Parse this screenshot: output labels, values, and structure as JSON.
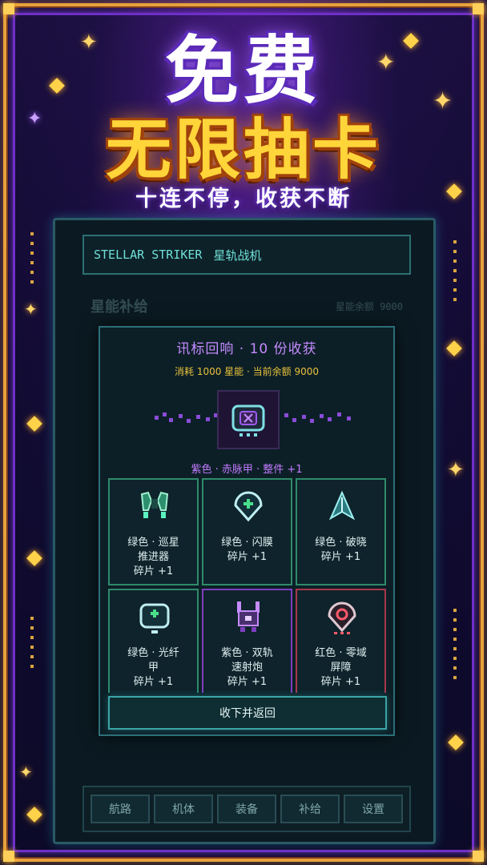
{
  "promo": {
    "title_top": "免费",
    "title_main": "无限抽卡",
    "subtitle": "十连不停，收获不断"
  },
  "app": {
    "name_en": "STELLAR STRIKER",
    "name_cn": "星轨战机",
    "section_title": "星能补给",
    "section_balance": "星能余额 9000"
  },
  "modal": {
    "title": "讯标回响 · 10 份收获",
    "subtitle": "消耗 1000 星能 · 当前余额 9000",
    "featured": {
      "label": "紫色 · 赤脉甲 · 整件 +1",
      "icon": "shield-emblem-icon",
      "color": "#9b5cf0"
    },
    "cards": [
      {
        "line1": "绿色 · 巡星",
        "line2": "推进器",
        "line3": "碎片 +1",
        "rarity": "green",
        "icon": "thruster-icon"
      },
      {
        "line1": "绿色 · 闪膜",
        "line2": "碎片 +1",
        "line3": "",
        "rarity": "green",
        "icon": "shield-pin-icon"
      },
      {
        "line1": "绿色 · 破晓",
        "line2": "碎片 +1",
        "line3": "",
        "rarity": "green",
        "icon": "arrow-ship-icon"
      },
      {
        "line1": "绿色 · 光纤",
        "line2": "甲",
        "line3": "碎片 +1",
        "rarity": "green",
        "icon": "armor-icon"
      },
      {
        "line1": "紫色 · 双轨",
        "line2": "速射炮",
        "line3": "碎片 +1",
        "rarity": "purple",
        "icon": "cannon-icon"
      },
      {
        "line1": "红色 · 零域",
        "line2": "屏障",
        "line3": "碎片 +1",
        "rarity": "red",
        "icon": "barrier-icon"
      }
    ],
    "confirm_label": "收下并返回"
  },
  "nav": {
    "items": [
      "航路",
      "机体",
      "装备",
      "补给",
      "设置"
    ]
  },
  "colors": {
    "gold": "#ffd53a",
    "purple": "#9b5cf0",
    "teal": "#6fe0d8",
    "green_border": "#2f8a6a",
    "purple_border": "#7e3fc0",
    "red_border": "#a8384a"
  }
}
